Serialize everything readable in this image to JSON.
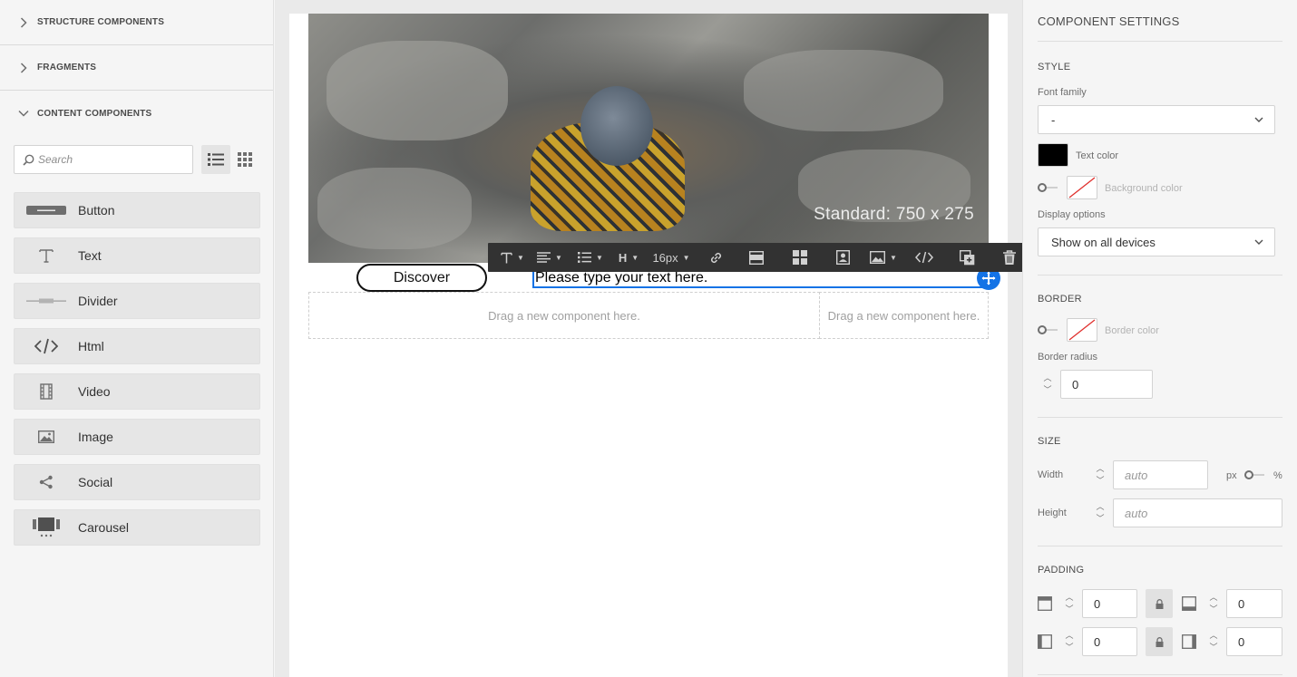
{
  "left_panel": {
    "sections": [
      {
        "label": "STRUCTURE COMPONENTS",
        "expanded": false
      },
      {
        "label": "FRAGMENTS",
        "expanded": false
      },
      {
        "label": "CONTENT COMPONENTS",
        "expanded": true
      }
    ],
    "search_placeholder": "Search",
    "components": [
      {
        "label": "Button",
        "icon": "button-icon"
      },
      {
        "label": "Text",
        "icon": "text-icon"
      },
      {
        "label": "Divider",
        "icon": "divider-icon"
      },
      {
        "label": "Html",
        "icon": "code-icon"
      },
      {
        "label": "Video",
        "icon": "film-icon"
      },
      {
        "label": "Image",
        "icon": "image-icon"
      },
      {
        "label": "Social",
        "icon": "share-icon"
      },
      {
        "label": "Carousel",
        "icon": "carousel-icon"
      }
    ]
  },
  "canvas": {
    "hero_label": "Standard: 750 x 275",
    "toolbar": {
      "font_size": "16px"
    },
    "button_label": "Discover",
    "text_value": "Please type your text here.",
    "drop_zones": [
      "Drag a new component here.",
      "Drag a new component here."
    ]
  },
  "right_panel": {
    "title": "COMPONENT SETTINGS",
    "style": {
      "heading": "STYLE",
      "font_family_label": "Font family",
      "font_family_value": "-",
      "text_color_label": "Text color",
      "text_color": "#000000",
      "bg_color_label": "Background color",
      "display_options_label": "Display options",
      "display_options_value": "Show on all devices"
    },
    "border": {
      "heading": "BORDER",
      "border_color_label": "Border color",
      "radius_label": "Border radius",
      "radius_value": "0"
    },
    "size": {
      "heading": "SIZE",
      "width_label": "Width",
      "width_placeholder": "auto",
      "unit_px": "px",
      "unit_pct": "%",
      "height_label": "Height",
      "height_placeholder": "auto"
    },
    "padding": {
      "heading": "PADDING",
      "top": "0",
      "bottom": "0",
      "left": "0",
      "right": "0"
    }
  }
}
